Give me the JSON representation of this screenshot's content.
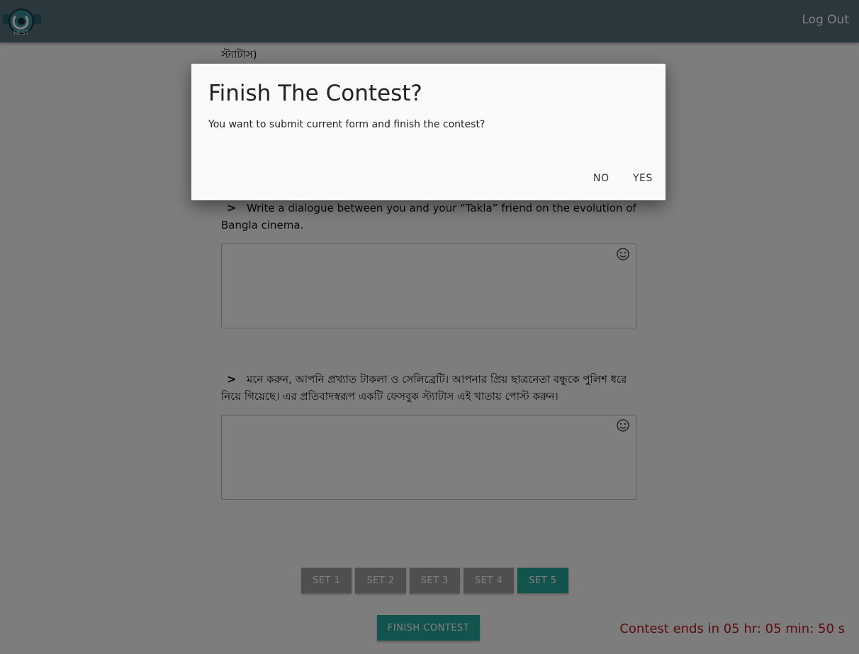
{
  "header": {
    "logo_text": "HACKFEST",
    "logout_label": "Log Out"
  },
  "main": {
    "status_tail": "স্ট্যাটাস)",
    "questions": [
      {
        "chevron": ">",
        "text": "Write a dialogue between you and your “Takla” friend on the evolution of Bangla cinema."
      },
      {
        "chevron": ">",
        "text": "মনে করুন, আপনি প্রখ্যাত টাকলা ও সেলিব্রেটি। আপনার প্রিয় ছাত্রনেতা বন্ধুকে পুলিশ ধরে নিয়ে গিয়েছে। এর প্রতিবাদস্বরূপ একটি ফেসবুক স্ট্যাটাস এই খাতায় পোস্ট করুন।"
      }
    ],
    "answers": [
      "",
      ""
    ],
    "emoji_icon": "smiley-icon"
  },
  "sets": {
    "items": [
      {
        "label": "SET 1",
        "active": false
      },
      {
        "label": "SET 2",
        "active": false
      },
      {
        "label": "SET 3",
        "active": false
      },
      {
        "label": "SET 4",
        "active": false
      },
      {
        "label": "SET 5",
        "active": true
      }
    ],
    "active_color": "#26a69a",
    "inactive_color": "#9e9e9e"
  },
  "finish_label": "FINISH CONTEST",
  "timer_text": "Contest ends in 05 hr: 05 min: 50 s",
  "modal": {
    "title": "Finish The Contest?",
    "message": "You want to submit current form and finish the contest?",
    "no_label": "NO",
    "yes_label": "YES"
  },
  "colors": {
    "navbar": "#546e7a",
    "accent": "#26a69a",
    "timer": "#b71c1c"
  }
}
